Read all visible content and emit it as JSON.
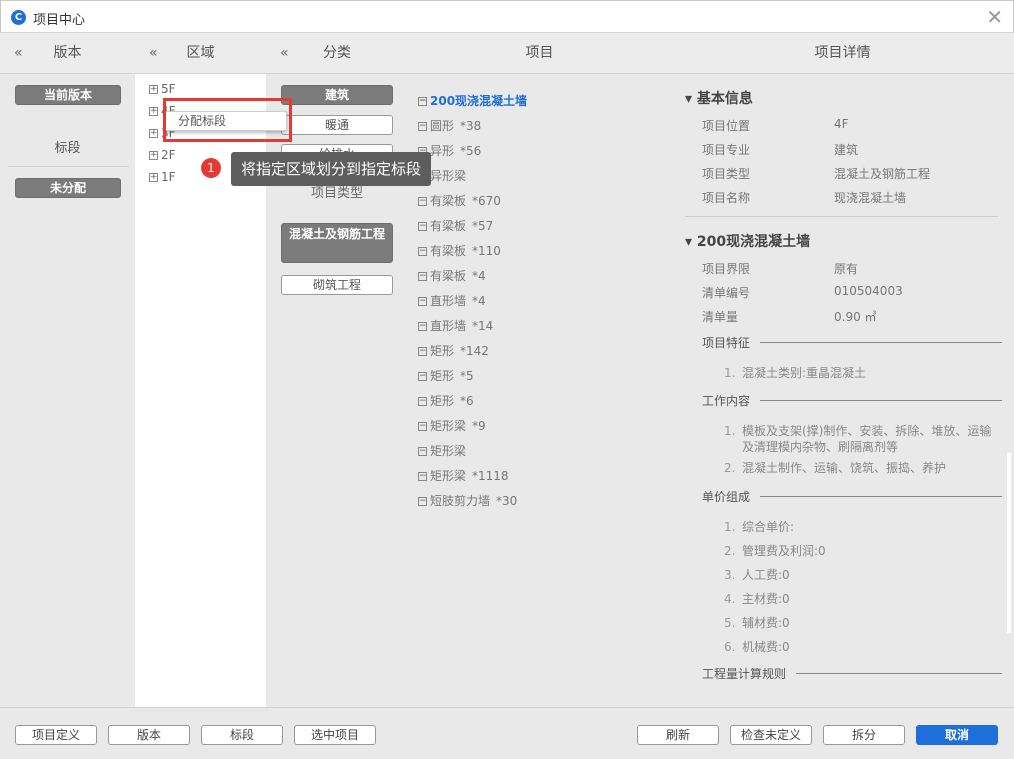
{
  "window": {
    "title": "项目中心",
    "logo_letter": "C"
  },
  "columns": {
    "version": {
      "header": "版本",
      "current_btn": "当前版本",
      "section_label": "标段",
      "unassigned_btn": "未分配"
    },
    "region": {
      "header": "区域",
      "floors": [
        "5F",
        "4F",
        "3F",
        "2F",
        "1F"
      ]
    },
    "category": {
      "header": "分类",
      "specialties": [
        "建筑",
        "暖通",
        "给排水"
      ],
      "type_label": "项目类型",
      "types": [
        "混凝土及钢筋工程",
        "砌筑工程"
      ]
    },
    "project": {
      "header": "项目",
      "items": [
        {
          "name": "200现浇混凝土墙",
          "count": "",
          "selected": true
        },
        {
          "name": "圆形",
          "count": "*38"
        },
        {
          "name": "异形",
          "count": "*56"
        },
        {
          "name": "异形梁",
          "count": ""
        },
        {
          "name": "有梁板",
          "count": "*670"
        },
        {
          "name": "有梁板",
          "count": "*57"
        },
        {
          "name": "有梁板",
          "count": "*110"
        },
        {
          "name": "有梁板",
          "count": "*4"
        },
        {
          "name": "直形墙",
          "count": "*4"
        },
        {
          "name": "直形墙",
          "count": "*14"
        },
        {
          "name": "矩形",
          "count": "*142"
        },
        {
          "name": "矩形",
          "count": "*5"
        },
        {
          "name": "矩形",
          "count": "*6"
        },
        {
          "name": "矩形梁",
          "count": "*9"
        },
        {
          "name": "矩形梁",
          "count": ""
        },
        {
          "name": "矩形梁",
          "count": "*1118"
        },
        {
          "name": "短肢剪力墙",
          "count": "*30"
        }
      ]
    },
    "details": {
      "header": "项目详情",
      "basic": {
        "title": "基本信息",
        "rows": [
          [
            "项目位置",
            "4F"
          ],
          [
            "项目专业",
            "建筑"
          ],
          [
            "项目类型",
            "混凝土及钢筋工程"
          ],
          [
            "项目名称",
            "现浇混凝土墙"
          ]
        ]
      },
      "item": {
        "title": "200现浇混凝土墙",
        "rows": [
          [
            "项目界限",
            "原有"
          ],
          [
            "清单编号",
            "010504003"
          ],
          [
            "清单量",
            "0.90 ㎥"
          ]
        ]
      },
      "features": {
        "title": "项目特征",
        "items": [
          "混凝土类别:重晶混凝土"
        ]
      },
      "work": {
        "title": "工作内容",
        "items": [
          "模板及支架(撑)制作、安装、拆除、堆放、运输及清理模内杂物、刷隔离剂等",
          "混凝土制作、运输、饶筑、振捣、养护"
        ]
      },
      "price": {
        "title": "单价组成",
        "items": [
          "综合单价:",
          "管理费及利润:0",
          "人工费:0",
          "主材费:0",
          "辅材费:0",
          "机械费:0"
        ]
      },
      "rules": {
        "title": "工程量计算规则"
      }
    }
  },
  "context_menu": {
    "item": "分配标段"
  },
  "tooltip": {
    "badge": "1",
    "text": "将指定区域划分到指定标段"
  },
  "bottom": {
    "left": [
      "项目定义",
      "版本",
      "标段",
      "选中项目"
    ],
    "right": [
      "刷新",
      "检查未定义",
      "拆分"
    ],
    "cancel": "取消"
  },
  "colors": {
    "accent": "#1e6fd9",
    "highlight": "#e53935",
    "dark_button": "#7b7b7b"
  }
}
